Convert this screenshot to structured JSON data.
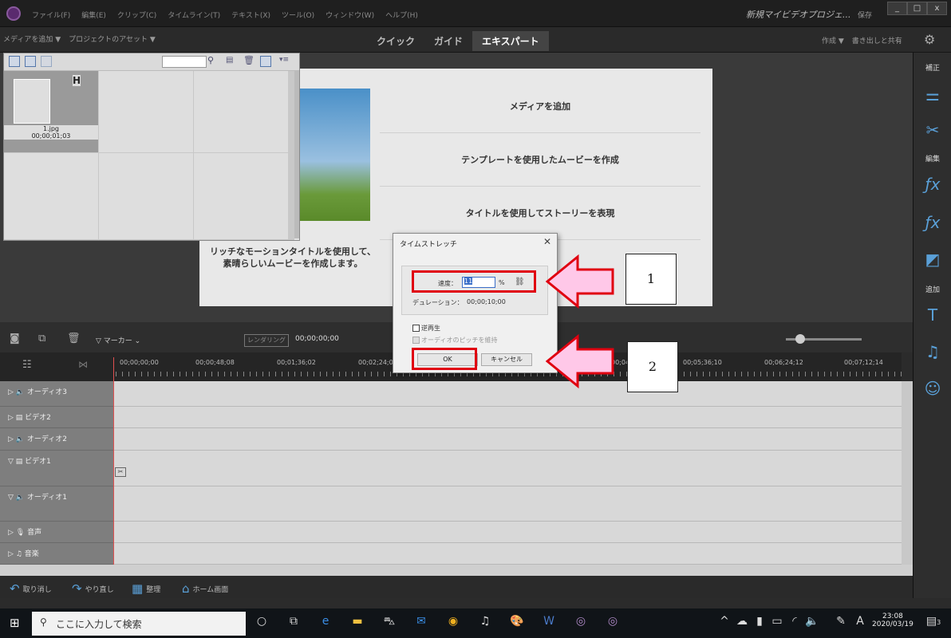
{
  "menubar": {
    "items": [
      "ファイル(F)",
      "編集(E)",
      "クリップ(C)",
      "タイムライン(T)",
      "テキスト(X)",
      "ツール(O)",
      "ウィンドウ(W)",
      "ヘルプ(H)"
    ],
    "project_title": "新規マイビデオプロジェ...",
    "save_label": "保存",
    "minimize": "_",
    "maximize": "□",
    "close": "x"
  },
  "modebar": {
    "add_media": "メディアを追加 ▼",
    "project_assets": "プロジェクトのアセット ▼",
    "modes": [
      "クイック",
      "ガイド",
      "エキスパート"
    ],
    "active_mode": "エキスパート",
    "create": "作成 ▼",
    "export_share": "書き出しと共有"
  },
  "assets": {
    "clip_name": "1.jpg",
    "clip_duration": "00;00;01;03",
    "clip_badge": "H"
  },
  "welcome": {
    "options": [
      "メディアを追加",
      "テンプレートを使用したムービーを作成",
      "タイトルを使用してストーリーを表現"
    ],
    "caption_line1": "リッチなモーションタイトルを使用して、",
    "caption_line2": "素晴らしいムービーを作成します。"
  },
  "timeline": {
    "marker": "マーカー",
    "render": "レンダリング",
    "timecode": "00;00;00;00",
    "ruler": [
      "00;00;00;00",
      "00;00;48;08",
      "00;01;36;02",
      "00;02;24;04",
      "00;04;48",
      "00;05;36;10",
      "00;06;24;12",
      "00;07;12;14"
    ],
    "tracks": [
      {
        "label": "オーディオ3",
        "icon": "audio"
      },
      {
        "label": "ビデオ2",
        "icon": "video"
      },
      {
        "label": "オーディオ2",
        "icon": "audio"
      },
      {
        "label": "ビデオ1",
        "icon": "video"
      },
      {
        "label": "オーディオ1",
        "icon": "audio"
      },
      {
        "label": "音声",
        "icon": "mic"
      },
      {
        "label": "音楽",
        "icon": "music"
      }
    ]
  },
  "rightpanel": {
    "correct": "補正",
    "edit": "編集",
    "add": "追加"
  },
  "bottombar": {
    "undo": "取り消し",
    "redo": "やり直し",
    "organize": "整理",
    "home": "ホーム画面"
  },
  "dialog": {
    "title": "タイムストレッチ",
    "speed_label": "速度：",
    "speed_value": "11",
    "percent": "%",
    "duration_label": "デュレーション：",
    "duration_value": "00;00;10;00",
    "reverse_label": "逆再生",
    "keep_pitch_label": "オーディオのピッチを維持",
    "ok": "OK",
    "cancel": "キャンセル"
  },
  "annotations": {
    "box1": "1",
    "box2": "2",
    "arrow_color": "#ffc8e8",
    "highlight_color": "#e00010"
  },
  "taskbar": {
    "search_placeholder": "ここに入力して検索",
    "time": "23:08",
    "date": "2020/03/19",
    "notification_count": "3"
  }
}
